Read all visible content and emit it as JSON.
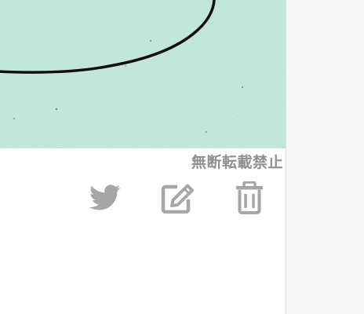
{
  "artwork": {
    "background_color": "#c9f1e2",
    "line_color": "#111111"
  },
  "copyright_notice": "無断転載禁止",
  "actions": {
    "twitter_icon": "twitter-bird-icon",
    "edit_icon": "pencil-square-icon",
    "delete_icon": "trash-icon",
    "icon_color": "#a6a6a6"
  }
}
